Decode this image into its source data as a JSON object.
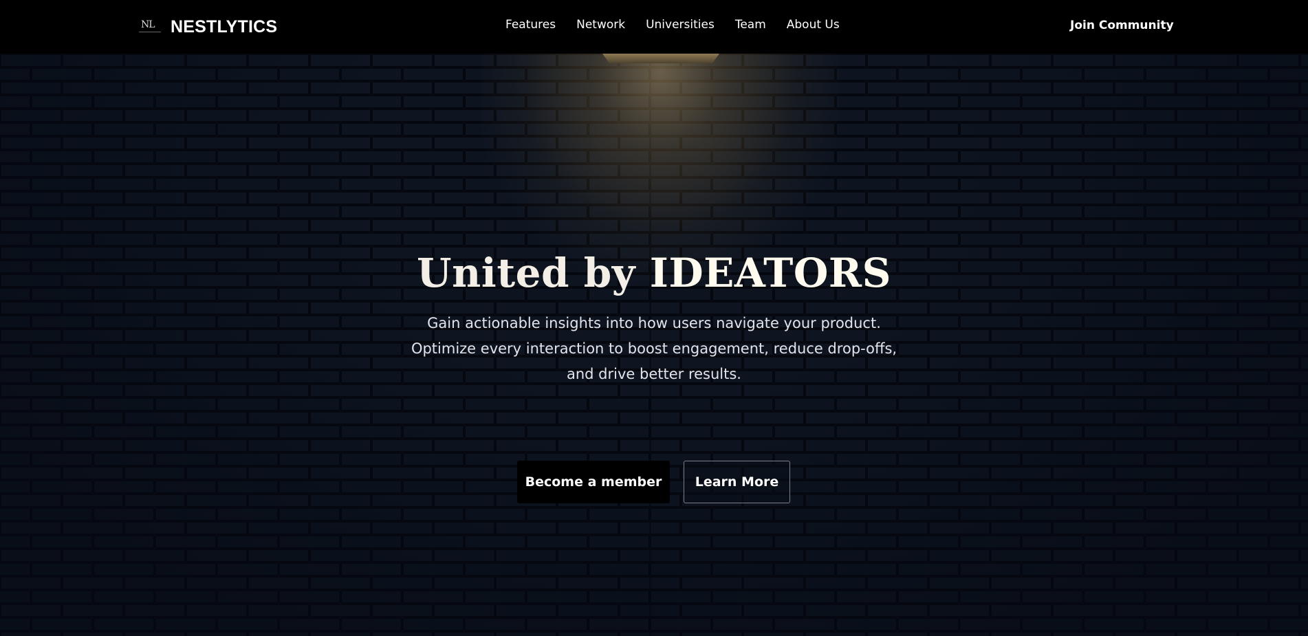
{
  "header": {
    "logo_letters": "NL",
    "brand": "NESTLYTICS",
    "nav": [
      {
        "label": "Features"
      },
      {
        "label": "Network"
      },
      {
        "label": "Universities"
      },
      {
        "label": "Team"
      },
      {
        "label": "About Us"
      }
    ],
    "cta": "Join Community"
  },
  "hero": {
    "title_prefix": "United by",
    "title_emphasis": "IDEATORS",
    "subtitle_lines": [
      "Gain actionable insights into how users navigate your product.",
      "Optimize every interaction to boost engagement, reduce drop-offs,",
      "and drive better results."
    ],
    "primary_button": "Become a member",
    "secondary_button": "Learn More"
  },
  "colors": {
    "header_bg": "#000000",
    "hero_bg": "#070b14",
    "title_color": "#f3efe6",
    "lamp_glow": "#ffd68c"
  }
}
